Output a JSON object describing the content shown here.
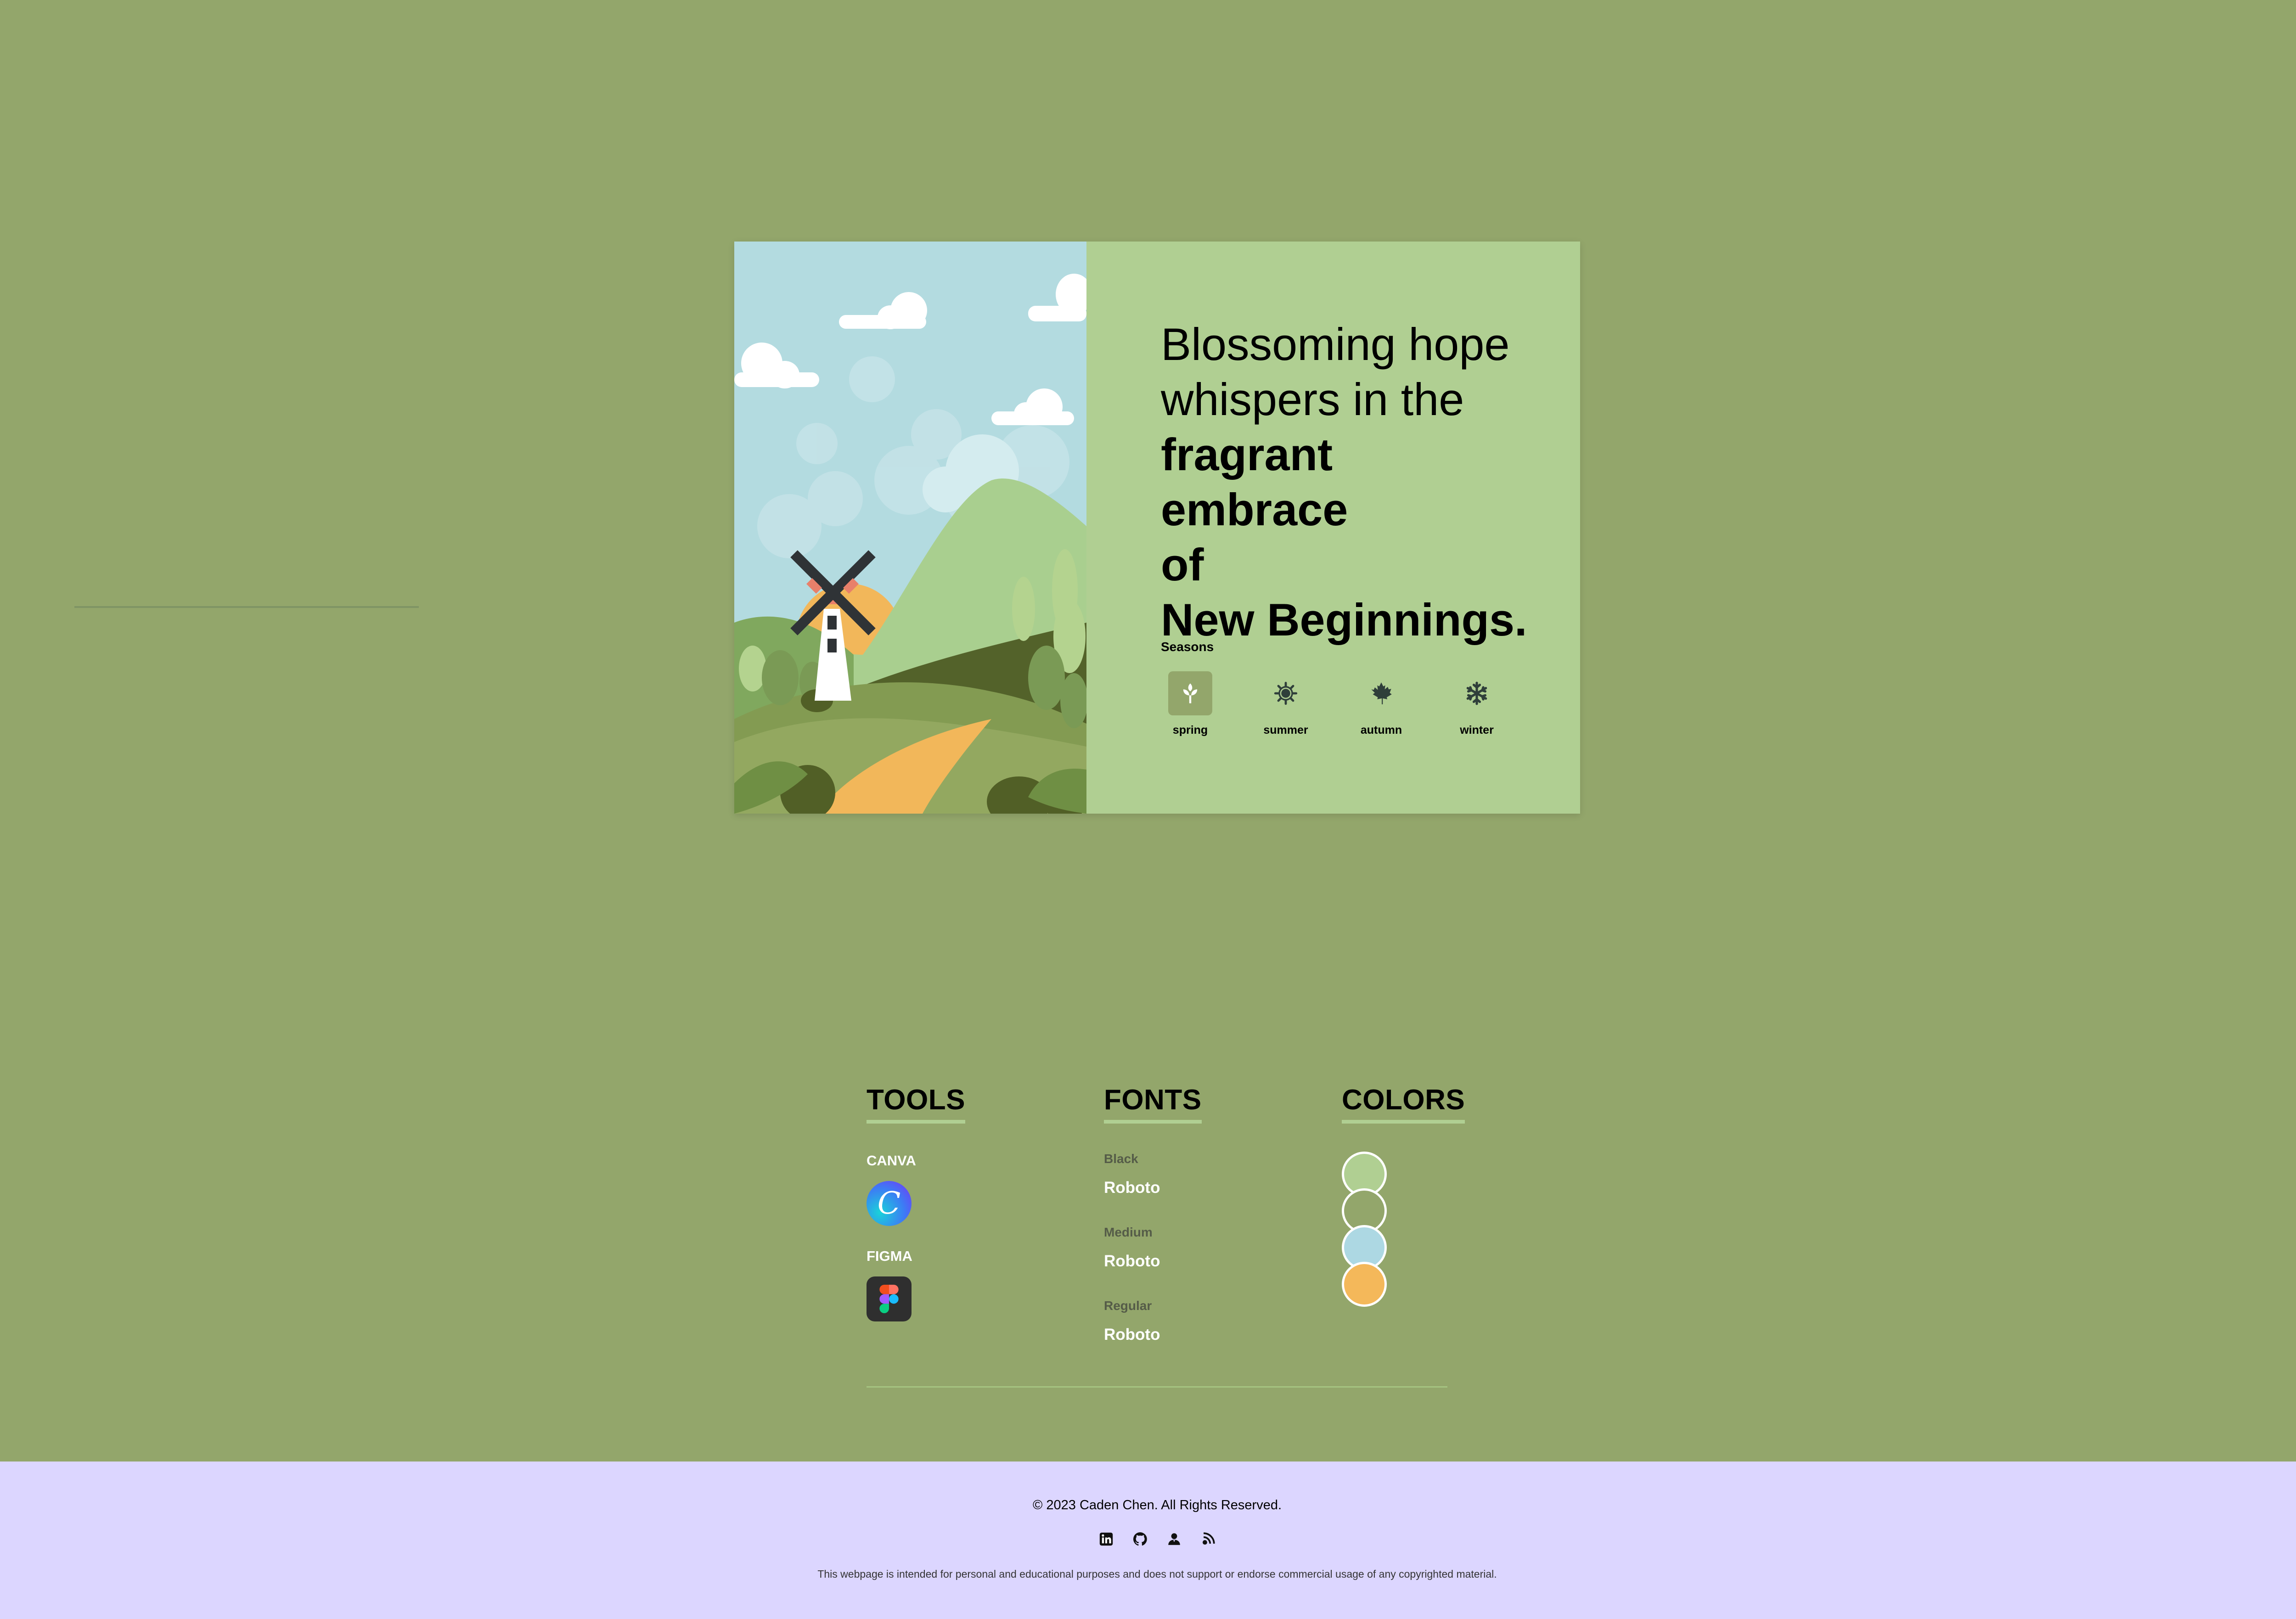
{
  "hero": {
    "headline_light_1": "Blossoming hope",
    "headline_light_2": "whispers in the",
    "headline_bold_1": "fragrant embrace",
    "headline_bold_2": "of",
    "headline_bold_3": "New Beginnings.",
    "seasons_label": "Seasons",
    "seasons": [
      {
        "label": "spring",
        "icon": "sprout-icon",
        "active": true
      },
      {
        "label": "summer",
        "icon": "sun-icon",
        "active": false
      },
      {
        "label": "autumn",
        "icon": "maple-leaf-icon",
        "active": false
      },
      {
        "label": "winter",
        "icon": "snowflake-icon",
        "active": false
      }
    ]
  },
  "tools": {
    "title": "TOOLS",
    "items": [
      {
        "name": "CANVA",
        "icon": "canva-logo-icon",
        "glyph": "C"
      },
      {
        "name": "FIGMA",
        "icon": "figma-logo-icon"
      }
    ]
  },
  "fonts": {
    "title": "FONTS",
    "items": [
      {
        "weight": "Black",
        "family": "Roboto"
      },
      {
        "weight": "Medium",
        "family": "Roboto"
      },
      {
        "weight": "Regular",
        "family": "Roboto"
      }
    ]
  },
  "colors": {
    "title": "COLORS",
    "swatches": [
      "#b0cf92",
      "#93a66b",
      "#add8e3",
      "#f4b85a"
    ]
  },
  "footer": {
    "copyright": "© 2023 Caden Chen. All Rights Reserved.",
    "social_icons": [
      "linkedin-icon",
      "github-icon",
      "portfolio-user-icon",
      "blog-icon"
    ],
    "disclaimer": "This webpage is intended for personal and educational purposes and does not support or endorse commercial usage of any copyrighted material."
  },
  "theme": {
    "background": "#93a66b",
    "card_green": "#b0cf92",
    "sky_blue": "#b5dbe0",
    "accent_orange": "#f4b85a",
    "footer_lavender": "#dcd6ff"
  }
}
